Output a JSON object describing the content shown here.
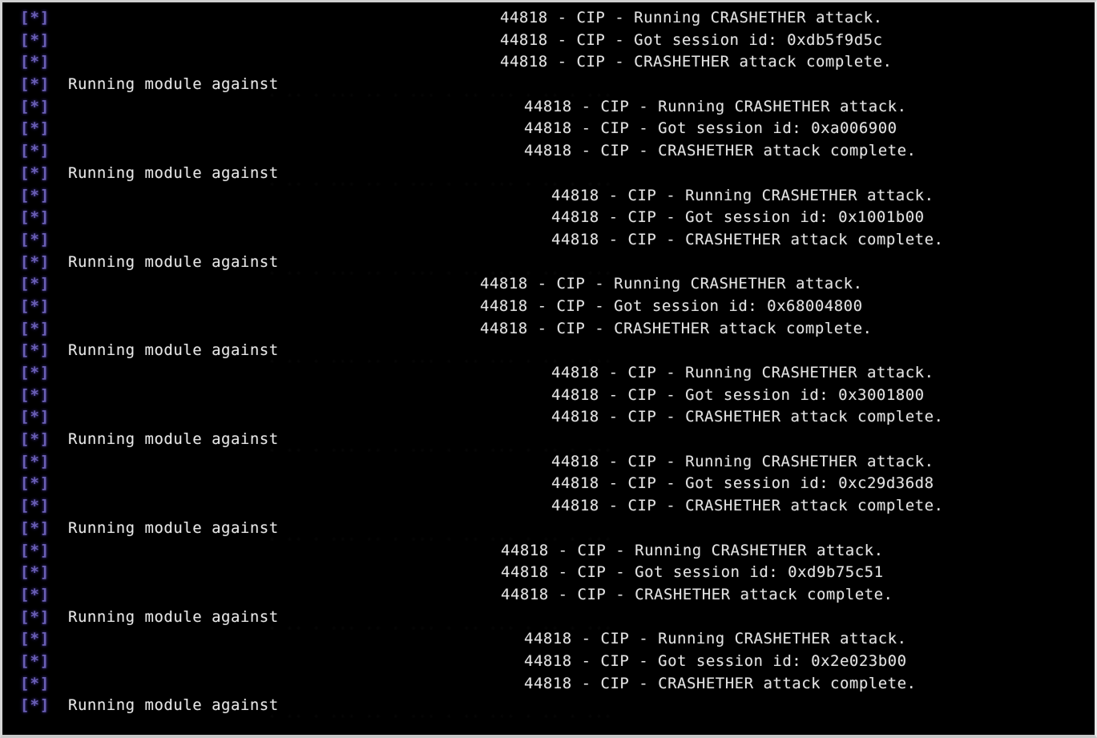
{
  "terminal": {
    "prefix": "[*]",
    "background_color": "#000000",
    "text_color": "#dcdcdc",
    "prefix_color": "#6a5fb5",
    "run_label": "Running module against",
    "pid": "44818",
    "protocol": "CIP",
    "messages": {
      "running_attack": "Running CRASHETHER attack.",
      "got_session": "Got session id:",
      "attack_complete": "CRASHETHER attack complete."
    },
    "lines": [
      {
        "type": "log",
        "indent": 621,
        "text": "44818 - CIP - Running CRASHETHER attack."
      },
      {
        "type": "log",
        "indent": 621,
        "text": "44818 - CIP - Got session id: 0xdb5f9d5c"
      },
      {
        "type": "log",
        "indent": 621,
        "text": "44818 - CIP - CRASHETHER attack complete."
      },
      {
        "type": "run",
        "indent": 82,
        "text": "Running module against"
      },
      {
        "type": "log",
        "indent": 651,
        "text": "44818 - CIP - Running CRASHETHER attack."
      },
      {
        "type": "log",
        "indent": 651,
        "text": "44818 - CIP - Got session id: 0xa006900"
      },
      {
        "type": "log",
        "indent": 651,
        "text": "44818 - CIP - CRASHETHER attack complete."
      },
      {
        "type": "run",
        "indent": 82,
        "text": "Running module against"
      },
      {
        "type": "log",
        "indent": 685,
        "text": "44818 - CIP - Running CRASHETHER attack."
      },
      {
        "type": "log",
        "indent": 685,
        "text": "44818 - CIP - Got session id: 0x1001b00"
      },
      {
        "type": "log",
        "indent": 685,
        "text": "44818 - CIP - CRASHETHER attack complete."
      },
      {
        "type": "run",
        "indent": 82,
        "text": "Running module against"
      },
      {
        "type": "log",
        "indent": 596,
        "text": "44818 - CIP - Running CRASHETHER attack."
      },
      {
        "type": "log",
        "indent": 596,
        "text": "44818 - CIP - Got session id: 0x68004800"
      },
      {
        "type": "log",
        "indent": 596,
        "text": "44818 - CIP - CRASHETHER attack complete."
      },
      {
        "type": "run",
        "indent": 82,
        "text": "Running module against"
      },
      {
        "type": "log",
        "indent": 685,
        "text": "44818 - CIP - Running CRASHETHER attack."
      },
      {
        "type": "log",
        "indent": 685,
        "text": "44818 - CIP - Got session id: 0x3001800"
      },
      {
        "type": "log",
        "indent": 685,
        "text": "44818 - CIP - CRASHETHER attack complete."
      },
      {
        "type": "run",
        "indent": 82,
        "text": "Running module against"
      },
      {
        "type": "log",
        "indent": 685,
        "text": "44818 - CIP - Running CRASHETHER attack."
      },
      {
        "type": "log",
        "indent": 685,
        "text": "44818 - CIP - Got session id: 0xc29d36d8"
      },
      {
        "type": "log",
        "indent": 685,
        "text": "44818 - CIP - CRASHETHER attack complete."
      },
      {
        "type": "run",
        "indent": 82,
        "text": "Running module against"
      },
      {
        "type": "log",
        "indent": 622,
        "text": "44818 - CIP - Running CRASHETHER attack."
      },
      {
        "type": "log",
        "indent": 622,
        "text": "44818 - CIP - Got session id: 0xd9b75c51"
      },
      {
        "type": "log",
        "indent": 622,
        "text": "44818 - CIP - CRASHETHER attack complete."
      },
      {
        "type": "run",
        "indent": 82,
        "text": "Running module against"
      },
      {
        "type": "log",
        "indent": 651,
        "text": "44818 - CIP - Running CRASHETHER attack."
      },
      {
        "type": "log",
        "indent": 651,
        "text": "44818 - CIP - Got session id: 0x2e023b00"
      },
      {
        "type": "log",
        "indent": 651,
        "text": "44818 - CIP - CRASHETHER attack complete."
      },
      {
        "type": "run",
        "indent": 82,
        "text": "Running module against"
      }
    ],
    "session_ids": [
      "0xdb5f9d5c",
      "0xa006900",
      "0x1001b00",
      "0x68004800",
      "0x3001800",
      "0xc29d36d8",
      "0xd9b75c51",
      "0x2e023b00"
    ]
  }
}
